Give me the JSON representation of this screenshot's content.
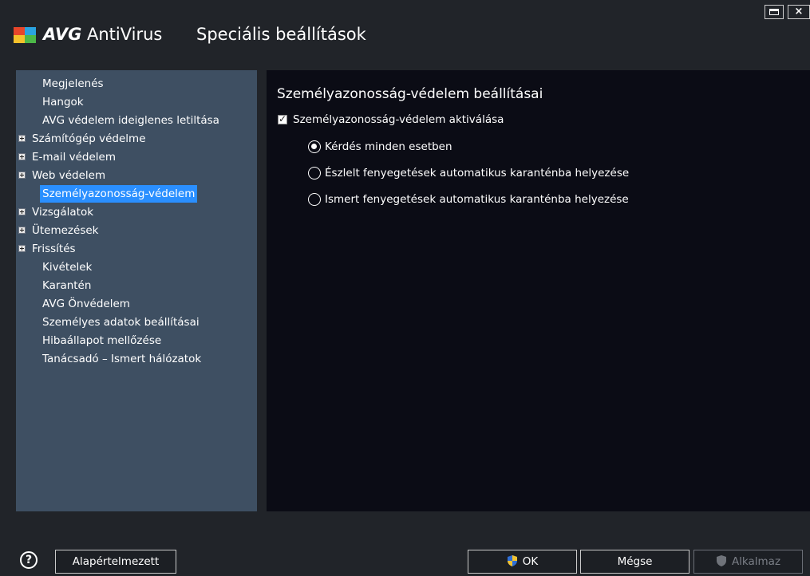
{
  "app": {
    "brand_bold": "AVG",
    "brand_rest": " AntiVirus",
    "window_title": "Speciális beállítások",
    "close_glyph": "×"
  },
  "sidebar": {
    "items": [
      {
        "label": "Megjelenés",
        "expandable": false,
        "selected": false
      },
      {
        "label": "Hangok",
        "expandable": false,
        "selected": false
      },
      {
        "label": "AVG védelem ideiglenes letiltása",
        "expandable": false,
        "selected": false
      },
      {
        "label": "Számítógép védelme",
        "expandable": true,
        "selected": false
      },
      {
        "label": "E-mail védelem",
        "expandable": true,
        "selected": false
      },
      {
        "label": "Web védelem",
        "expandable": true,
        "selected": false
      },
      {
        "label": "Személyazonosság-védelem",
        "expandable": false,
        "selected": true
      },
      {
        "label": "Vizsgálatok",
        "expandable": true,
        "selected": false
      },
      {
        "label": "Ütemezések",
        "expandable": true,
        "selected": false
      },
      {
        "label": "Frissítés",
        "expandable": true,
        "selected": false
      },
      {
        "label": "Kivételek",
        "expandable": false,
        "selected": false
      },
      {
        "label": "Karantén",
        "expandable": false,
        "selected": false
      },
      {
        "label": "AVG Önvédelem",
        "expandable": false,
        "selected": false
      },
      {
        "label": "Személyes adatok beállításai",
        "expandable": false,
        "selected": false
      },
      {
        "label": "Hibaállapot mellőzése",
        "expandable": false,
        "selected": false
      },
      {
        "label": "Tanácsadó – Ismert hálózatok",
        "expandable": false,
        "selected": false
      }
    ]
  },
  "main": {
    "section_title": "Személyazonosság-védelem beállításai",
    "activate_checkbox": {
      "label": "Személyazonosság-védelem aktiválása",
      "checked": true
    },
    "radio_options": [
      {
        "label": "Kérdés minden esetben",
        "selected": true
      },
      {
        "label": "Észlelt fenyegetések automatikus karanténba helyezése",
        "selected": false
      },
      {
        "label": "Ismert fenyegetések automatikus karanténba helyezése",
        "selected": false
      }
    ]
  },
  "footer": {
    "help_glyph": "?",
    "default_label": "Alapértelmezett",
    "ok_label": "OK",
    "cancel_label": "Mégse",
    "apply_label": "Alkalmaz"
  },
  "colors": {
    "background": "#212429",
    "sidebar": "#3e4f62",
    "main_panel": "#0b0c15",
    "selection": "#2a8fff"
  },
  "icons": {
    "logo": "avg-logo",
    "help": "help-icon",
    "shield": "uac-shield-icon",
    "expand": "plus-box-icon"
  }
}
